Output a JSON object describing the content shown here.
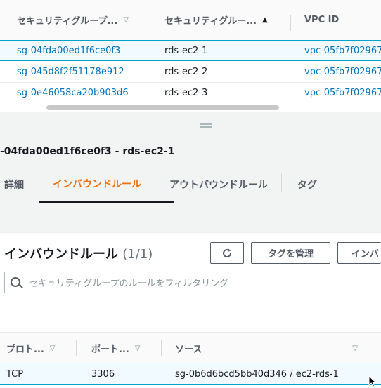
{
  "security_groups_table": {
    "columns": [
      {
        "label": "セキュリティグループ...",
        "sort_icon": "▽"
      },
      {
        "label": "セキュリティグルー...",
        "sort_icon": "▲"
      },
      {
        "label": "VPC ID"
      }
    ],
    "rows": [
      {
        "group_id": "sg-04fda00ed1f6ce0f3",
        "name": "rds-ec2-1",
        "vpc_id": "vpc-05fb7f02967",
        "selected": true
      },
      {
        "group_id": "sg-045d8f2f51178e912",
        "name": "rds-ec2-2",
        "vpc_id": "vpc-05fb7f02967",
        "selected": false
      },
      {
        "group_id": "sg-0e46058ca20b903d6",
        "name": "rds-ec2-3",
        "vpc_id": "vpc-05fb7f02967",
        "selected": false
      }
    ]
  },
  "details": {
    "title": "-04fda00ed1f6ce0f3 - rds-ec2-1",
    "tabs": [
      {
        "label": "詳細"
      },
      {
        "label": "インバウンドルール",
        "active": true
      },
      {
        "label": "アウトバウンドルール"
      },
      {
        "label": "タグ"
      }
    ]
  },
  "inbound_rules": {
    "title": "インバウンドルール",
    "count": "(1/1)",
    "refresh_icon": "refresh-icon",
    "manage_tags_label": "タグを管理",
    "edit_label": "インバ",
    "search_placeholder": "セキュリティグループのルールをフィルタリング",
    "columns": [
      {
        "label": "プロト...",
        "sort_icon": "▽"
      },
      {
        "label": "ポート...",
        "sort_icon": "▽"
      },
      {
        "label": "ソース",
        "sort_icon": "▽"
      }
    ],
    "rows": [
      {
        "protocol": "TCP",
        "port": "3306",
        "source": "sg-0b6d6bcd5bb40d346 / ec2-rds-1"
      }
    ]
  },
  "colors": {
    "link": "#0073bb",
    "active_tab": "#ec7211",
    "selected_row_border": "#00a1c9"
  }
}
